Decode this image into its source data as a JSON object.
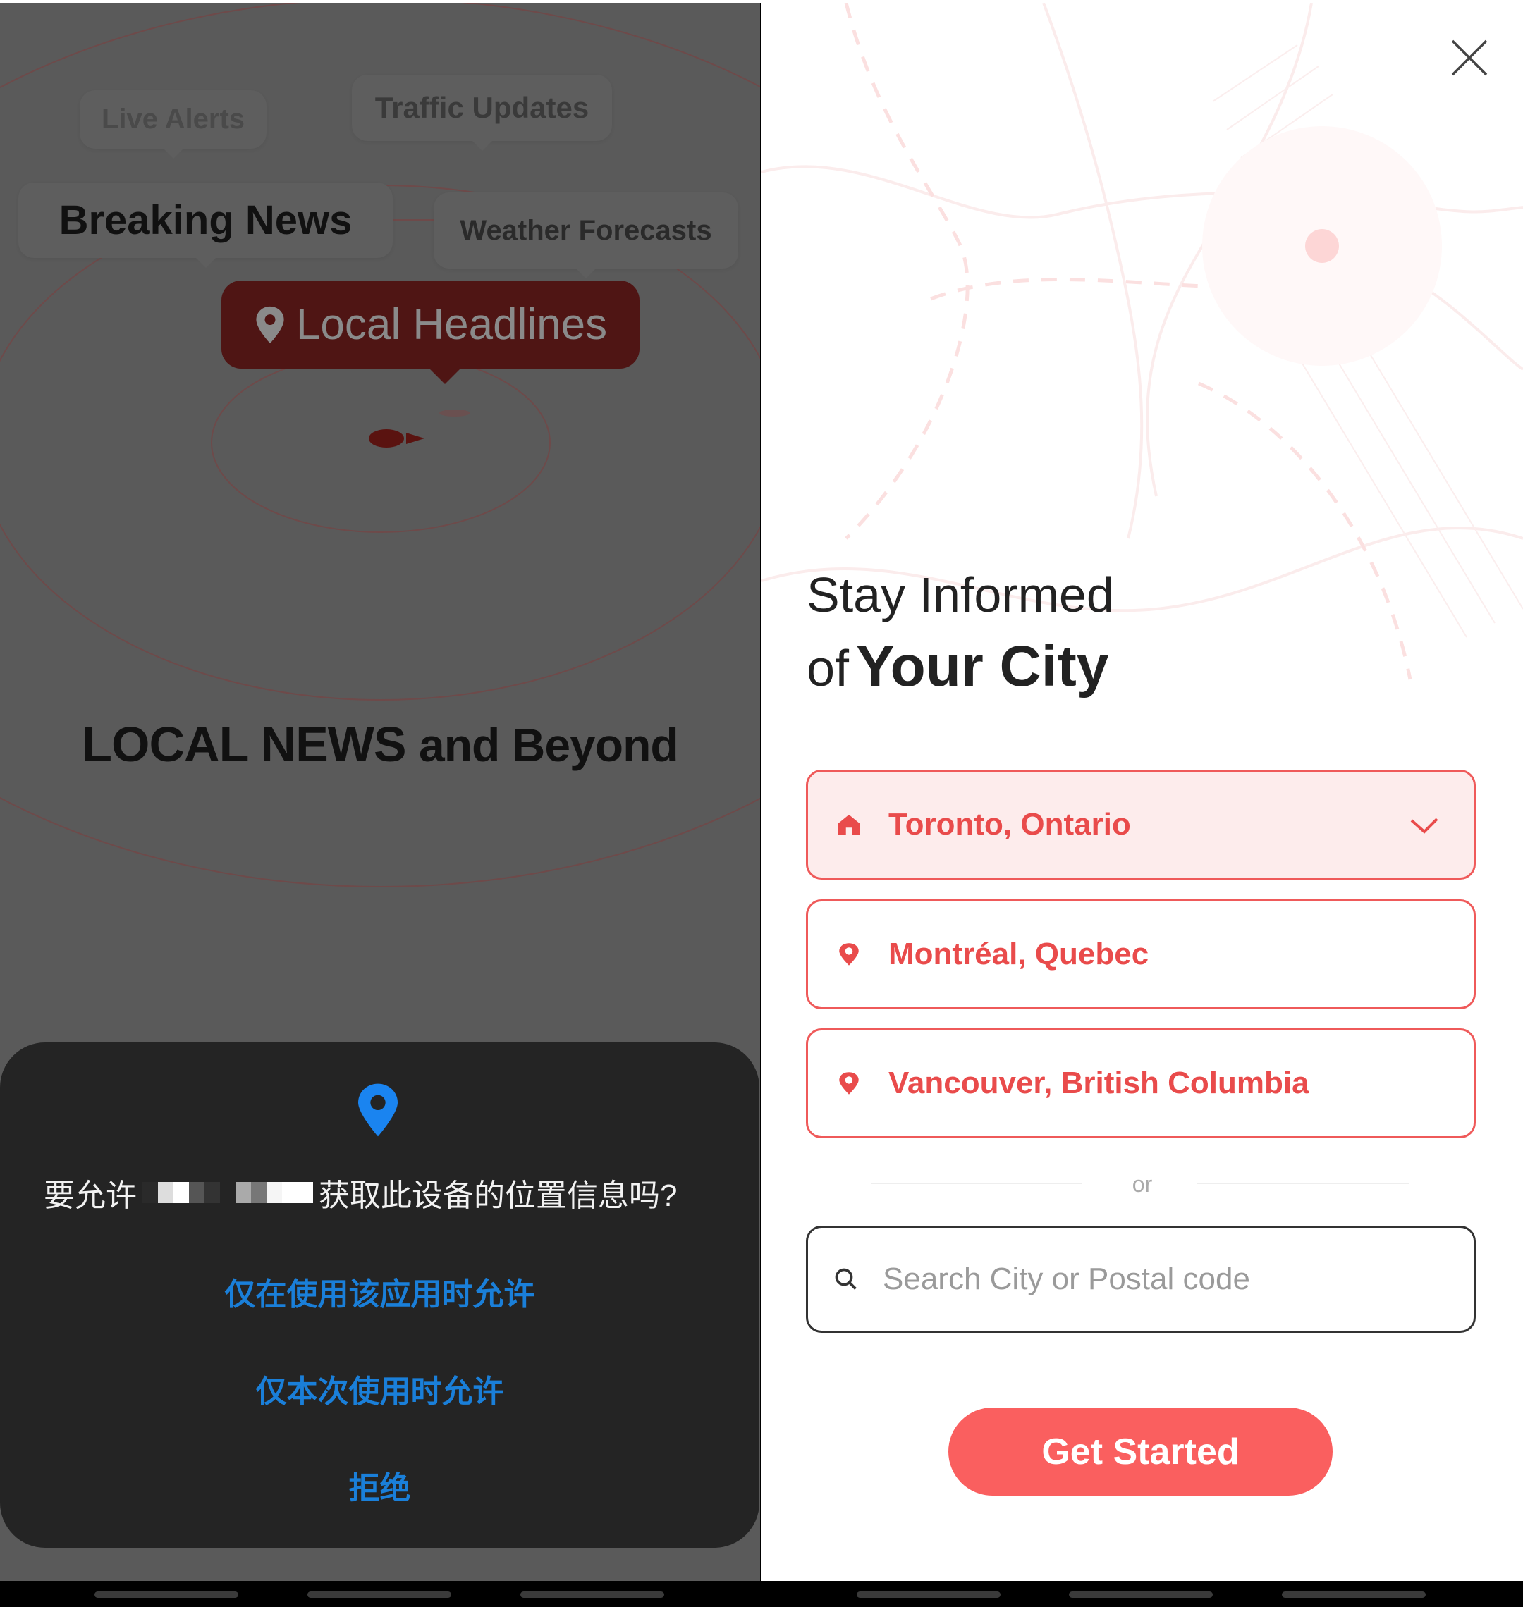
{
  "left_screen": {
    "bubbles": {
      "live_alerts": "Live Alerts",
      "traffic_updates": "Traffic Updates",
      "breaking_news": "Breaking News",
      "weather_forecasts": "Weather Forecasts",
      "local_headlines": "Local Headlines"
    },
    "tagline_bold": "LOCAL NEWS",
    "tagline_rest": "and Beyond",
    "permission_dialog": {
      "icon": "location-pin-icon",
      "question_prefix": "要允许",
      "question_suffix": "获取此设备的位置信息吗?",
      "options": [
        "仅在使用该应用时允许",
        "仅本次使用时允许",
        "拒绝"
      ],
      "accent_color": "#1a7fd9"
    }
  },
  "right_screen": {
    "close_icon": "close-icon",
    "title_line1": "Stay Informed",
    "title_of": "of",
    "title_bold": "Your City",
    "cities": [
      {
        "label": "Toronto, Ontario",
        "icon": "home-icon",
        "selected": true
      },
      {
        "label": "Montréal, Quebec",
        "icon": "location-pin-icon",
        "selected": false
      },
      {
        "label": "Vancouver, British Columbia",
        "icon": "location-pin-icon",
        "selected": false
      }
    ],
    "or_label": "or",
    "search": {
      "placeholder": "Search City or Postal code",
      "value": ""
    },
    "get_started": "Get Started",
    "accent_color": "#fa5f5f"
  }
}
